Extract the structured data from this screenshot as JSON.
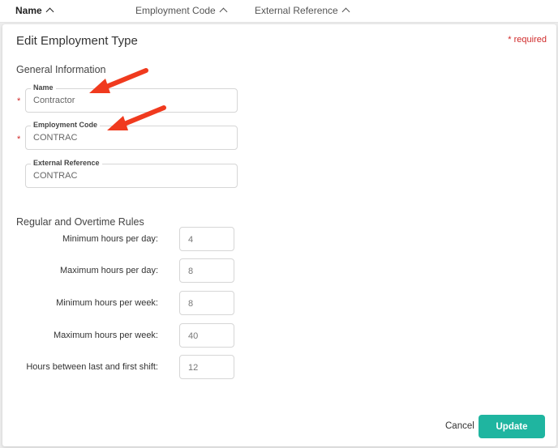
{
  "table_header": {
    "name": "Name",
    "employment_code": "Employment Code",
    "external_reference": "External Reference"
  },
  "modal": {
    "title": "Edit Employment Type",
    "required_note": "* required",
    "general_section": "General Information",
    "fields": [
      {
        "label": "Name",
        "value": "Contractor",
        "required": true
      },
      {
        "label": "Employment Code",
        "value": "CONTRAC",
        "required": true
      },
      {
        "label": "External Reference",
        "value": "CONTRAC",
        "required": false
      }
    ],
    "required_marker": "*",
    "rules_section": "Regular and Overtime Rules",
    "rules": [
      {
        "label": "Minimum hours per day:",
        "value": "4"
      },
      {
        "label": "Maximum hours per day:",
        "value": "8"
      },
      {
        "label": "Minimum hours per week:",
        "value": "8"
      },
      {
        "label": "Maximum hours per week:",
        "value": "40"
      },
      {
        "label": "Hours between last and first shift:",
        "value": "12"
      }
    ],
    "cancel_label": "Cancel",
    "update_label": "Update"
  },
  "colors": {
    "accent": "#1fb5a0",
    "required": "#d02a2a",
    "annotation_arrow": "#f03a1e"
  },
  "annotations": {
    "arrow_icon": "red-arrow-icon"
  }
}
